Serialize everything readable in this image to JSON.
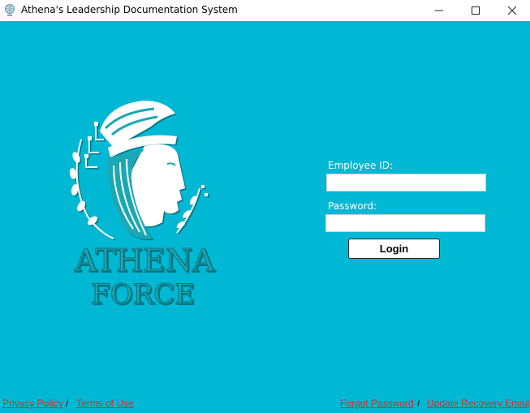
{
  "window": {
    "title": "Athena's Leadership Documentation System",
    "controls": {
      "minimize": "—",
      "maximize": "☐",
      "close": "✕"
    }
  },
  "logo": {
    "line1": "ATHENA",
    "line2": "FORCE"
  },
  "form": {
    "employee_id_label": "Employee ID:",
    "employee_id_value": "",
    "password_label": "Password:",
    "password_value": "",
    "login_label": "Login"
  },
  "footer": {
    "privacy_policy": "Privacy Policy",
    "terms_of_use": "Terms of Use",
    "forgot_password": "Forgot Password",
    "update_recovery_email": "Update Recovery Email",
    "separator": "/"
  },
  "colors": {
    "background": "#00b8d4",
    "logo_teal": "#1aa8b3",
    "logo_white": "#ffffff",
    "link_red": "#d32f2f"
  }
}
